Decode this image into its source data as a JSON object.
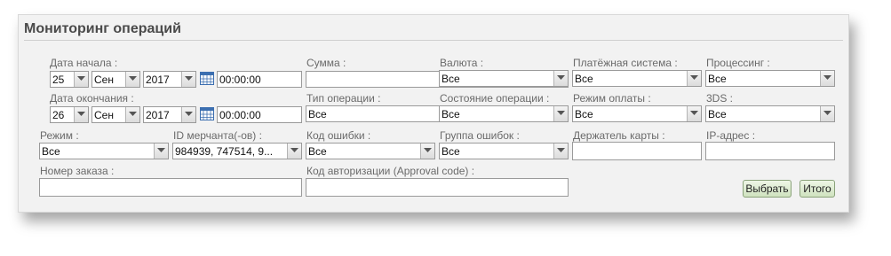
{
  "title": "Мониторинг операций",
  "fields": {
    "date_start": {
      "label": "Дата начала :",
      "day": "25",
      "month": "Сен",
      "year": "2017",
      "time": "00:00:00"
    },
    "date_end": {
      "label": "Дата окончания :",
      "day": "26",
      "month": "Сен",
      "year": "2017",
      "time": "00:00:00"
    },
    "amount": {
      "label": "Сумма :",
      "value": ""
    },
    "currency": {
      "label": "Валюта :",
      "value": "Все"
    },
    "payment_system": {
      "label": "Платёжная система :",
      "value": "Все"
    },
    "processing": {
      "label": "Процессинг :",
      "value": "Все"
    },
    "operation_type": {
      "label": "Тип операции :",
      "value": "Все"
    },
    "operation_state": {
      "label": "Состояние операции :",
      "value": "Все"
    },
    "payment_mode": {
      "label": "Режим оплаты :",
      "value": "Все"
    },
    "three_ds": {
      "label": "3DS :",
      "value": "Все"
    },
    "mode": {
      "label": "Режим :",
      "value": "Все"
    },
    "merchant_id": {
      "label": "ID мерчанта(-ов) :",
      "value": "984939, 747514, 9..."
    },
    "error_code": {
      "label": "Код ошибки :",
      "value": "Все"
    },
    "error_group": {
      "label": "Группа ошибок :",
      "value": "Все"
    },
    "card_holder": {
      "label": "Держатель карты :",
      "value": ""
    },
    "ip_address": {
      "label": "IP-адрес :",
      "value": ""
    },
    "order_number": {
      "label": "Номер заказа :",
      "value": ""
    },
    "approval_code": {
      "label": "Код авторизации (Approval code) :",
      "value": ""
    }
  },
  "buttons": {
    "select": "Выбрать",
    "total": "Итого"
  },
  "colors": {
    "panel_bg": "#f2f2f2",
    "button_bg": "#cfe2bf",
    "title": "#4a4a4a"
  },
  "icons": {
    "calendar": "calendar-icon",
    "dropdown": "chevron-down-icon"
  }
}
